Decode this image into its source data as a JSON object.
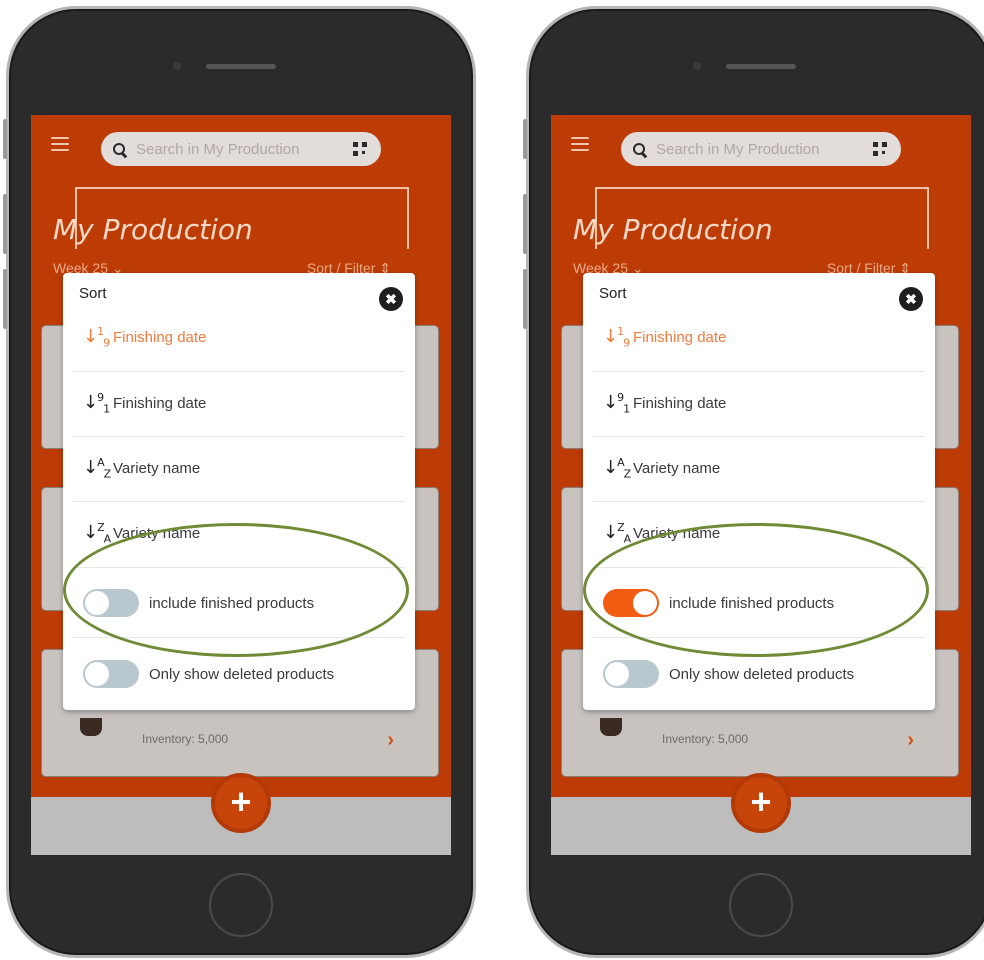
{
  "screens": [
    {
      "search_placeholder": "Search in My Production",
      "page_title": "My Production",
      "week_label": "Week 25",
      "sort_filter_label": "Sort / Filter",
      "cards": [
        {
          "inventory": ""
        },
        {
          "inventory": ""
        },
        {
          "inventory": "Inventory: 5,000"
        }
      ],
      "modal": {
        "title": "Sort",
        "items": [
          {
            "icon_top": "1",
            "icon_bottom": "9",
            "label": "Finishing date",
            "active": true
          },
          {
            "icon_top": "9",
            "icon_bottom": "1",
            "label": "Finishing date",
            "active": false
          },
          {
            "icon_top": "A",
            "icon_bottom": "Z",
            "label": "Variety name",
            "active": false
          },
          {
            "icon_top": "Z",
            "icon_bottom": "A",
            "label": "Variety name",
            "active": false
          }
        ],
        "toggles": [
          {
            "label": "include finished products",
            "on": false
          },
          {
            "label": "Only show deleted products",
            "on": false
          }
        ]
      }
    },
    {
      "search_placeholder": "Search in My Production",
      "page_title": "My Production",
      "week_label": "Week 25",
      "sort_filter_label": "Sort / Filter",
      "cards": [
        {
          "inventory": ""
        },
        {
          "inventory": ""
        },
        {
          "inventory": "Inventory: 5,000"
        }
      ],
      "modal": {
        "title": "Sort",
        "items": [
          {
            "icon_top": "1",
            "icon_bottom": "9",
            "label": "Finishing date",
            "active": true
          },
          {
            "icon_top": "9",
            "icon_bottom": "1",
            "label": "Finishing date",
            "active": false
          },
          {
            "icon_top": "A",
            "icon_bottom": "Z",
            "label": "Variety name",
            "active": false
          },
          {
            "icon_top": "Z",
            "icon_bottom": "A",
            "label": "Variety name",
            "active": false
          }
        ],
        "toggles": [
          {
            "label": "include finished products",
            "on": true
          },
          {
            "label": "Only show deleted products",
            "on": false
          }
        ]
      }
    }
  ],
  "colors": {
    "accent": "#bd3c05",
    "toggle_on": "#f25c12",
    "toggle_off": "#b9c7cf",
    "highlight": "#6f8b36",
    "active_text": "#f07a3c"
  }
}
